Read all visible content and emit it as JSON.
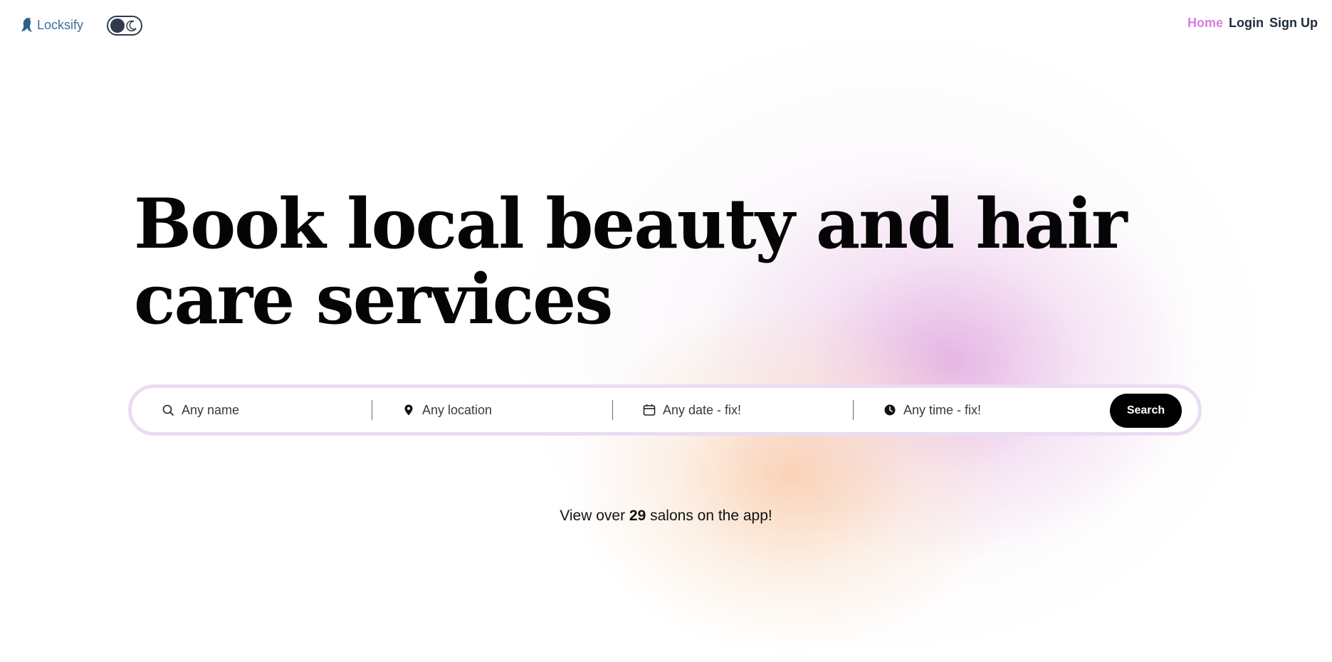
{
  "header": {
    "brand": "Locksify",
    "nav": [
      {
        "label": "Home",
        "active": true
      },
      {
        "label": "Login",
        "active": false
      },
      {
        "label": "Sign Up",
        "active": false
      }
    ]
  },
  "theme_toggle": {
    "icon": "moon-icon"
  },
  "hero": {
    "title": "Book local beauty and hair care services"
  },
  "search": {
    "name_placeholder": "Any name",
    "location_placeholder": "Any location",
    "date_placeholder": "Any date - fix!",
    "time_placeholder": "Any time - fix!",
    "button_label": "Search",
    "icons": [
      "search-icon",
      "location-pin-icon",
      "calendar-icon",
      "clock-icon"
    ]
  },
  "stats": {
    "prefix": "View over",
    "count": "29",
    "suffix": "salons on the app!"
  },
  "colors": {
    "accent": "#d77ee0",
    "brand": "#3c6e9a",
    "button": "#000000",
    "search_border": "#eadcf2"
  }
}
